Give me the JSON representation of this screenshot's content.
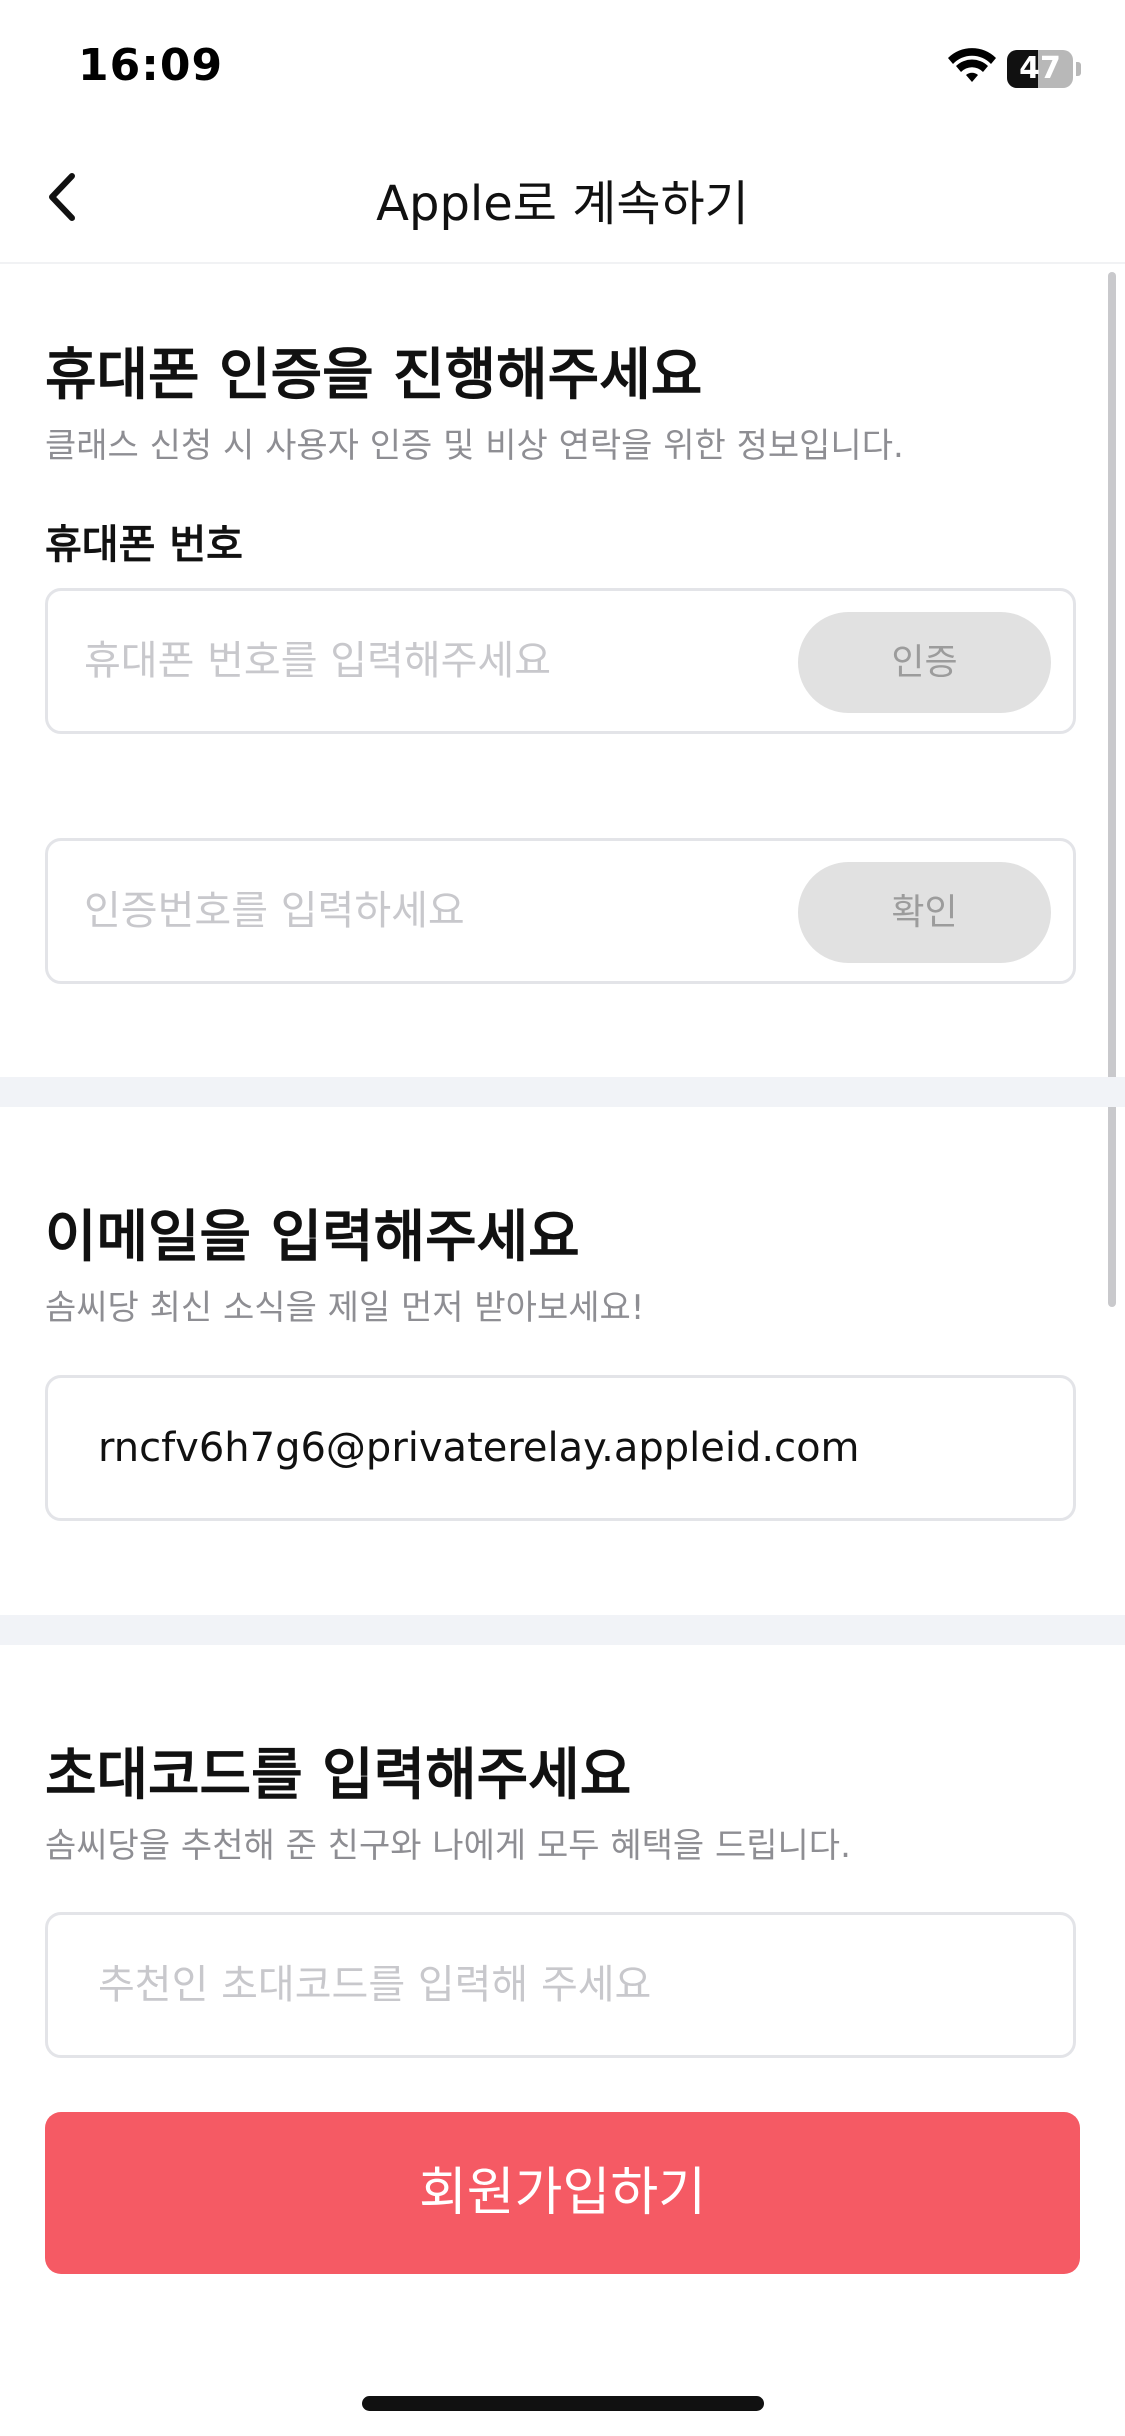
{
  "status_bar": {
    "time": "16:09",
    "battery_level": "47",
    "battery_fraction": 0.47,
    "wifi_icon": "wifi-icon",
    "battery_icon": "battery-icon"
  },
  "nav": {
    "title": "Apple로 계속하기",
    "back_icon": "chevron-left-icon"
  },
  "phone_section": {
    "title": "휴대폰 인증을 진행해주세요",
    "description": "클래스 신청 시 사용자 인증 및 비상 연락을 위한 정보입니다.",
    "phone_label": "휴대폰 번호",
    "phone_placeholder": "휴대폰 번호를 입력해주세요",
    "phone_value": "",
    "verify_button": "인증",
    "code_placeholder": "인증번호를 입력하세요",
    "code_value": "",
    "confirm_button": "확인"
  },
  "email_section": {
    "title": "이메일을 입력해주세요",
    "description": "솜씨당 최신 소식을 제일 먼저 받아보세요!",
    "email_value": "rncfv6h7g6@privaterelay.appleid.com"
  },
  "invite_section": {
    "title": "초대코드를 입력해주세요",
    "description": "솜씨당을 추천해 준 친구와 나에게 모두 혜택을 드립니다.",
    "invite_placeholder": "추천인 초대코드를 입력해 주세요",
    "invite_value": ""
  },
  "signup_button": "회원가입하기",
  "colors": {
    "accent": "#f55a64",
    "disabled_button": "#e1e1e1",
    "divider": "#f1f3f7",
    "placeholder": "#c8c8cc",
    "muted_text": "#8e8e93"
  }
}
